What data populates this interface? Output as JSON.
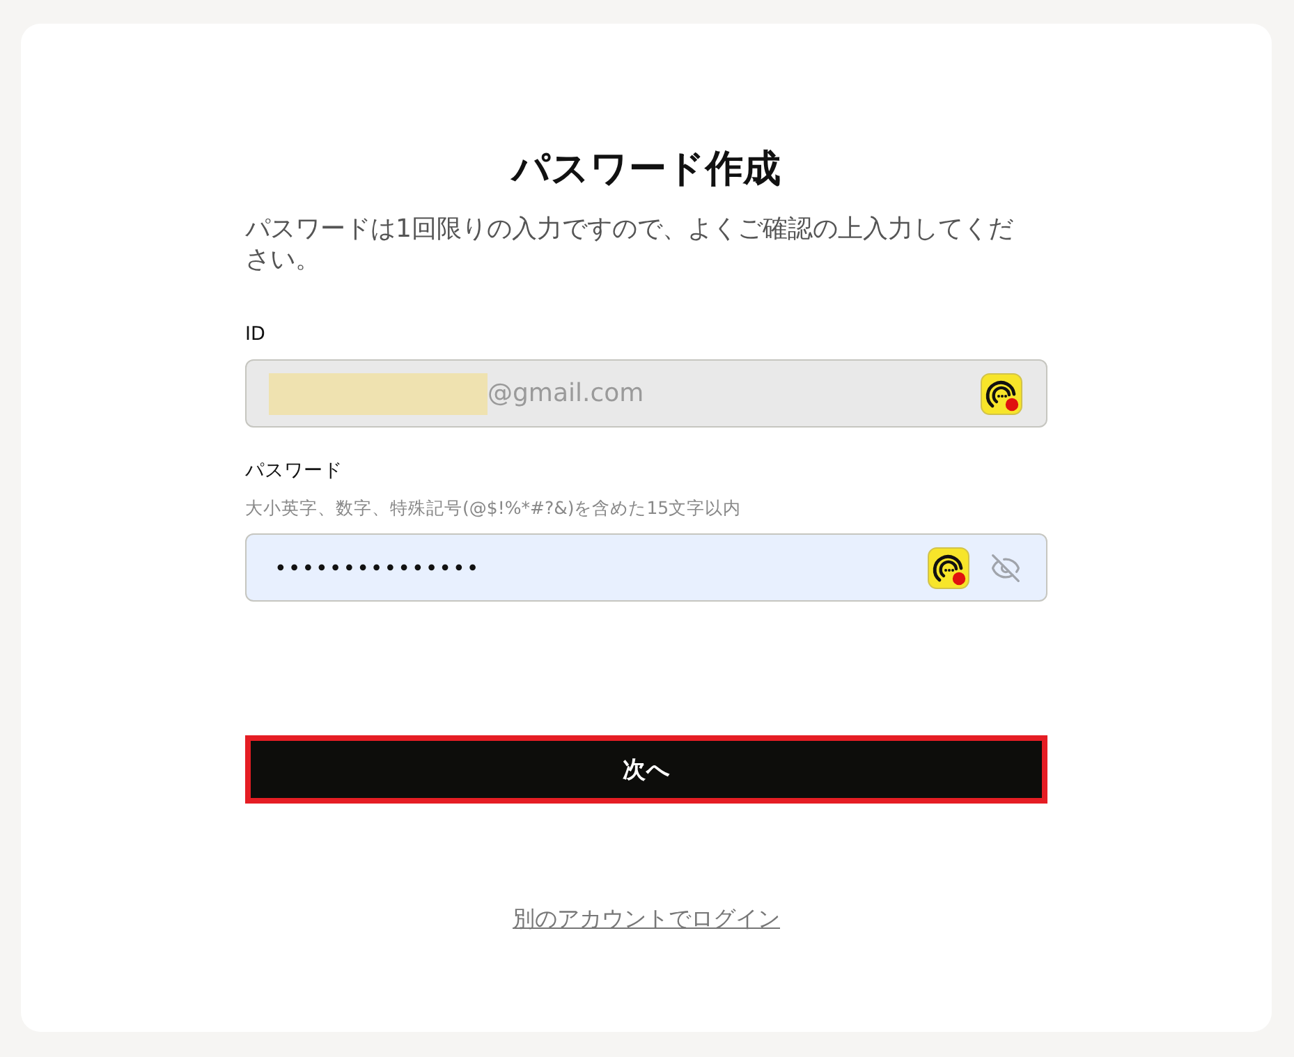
{
  "page": {
    "title": "パスワード作成",
    "description": "パスワードは1回限りの入力ですので、よくご確認の上入力してください。"
  },
  "fields": [
    {
      "kind": "email",
      "label": "ID",
      "value": "@gmail.com",
      "redacted": true,
      "disabled": true,
      "autofilled": false,
      "autofill_icon": true,
      "reveal_toggle": false
    },
    {
      "kind": "password",
      "label": "パスワード",
      "hint": "大小英字、数字、特殊記号(@$!%*#?&)を含めた15文字以内",
      "value": "•••••••••••••••",
      "redacted": false,
      "disabled": false,
      "autofilled": true,
      "autofill_icon": true,
      "reveal_toggle": true
    }
  ],
  "next_button": {
    "label": "次へ",
    "focused": true
  },
  "switch_account_link": {
    "label": "別のアカウントでログイン"
  }
}
